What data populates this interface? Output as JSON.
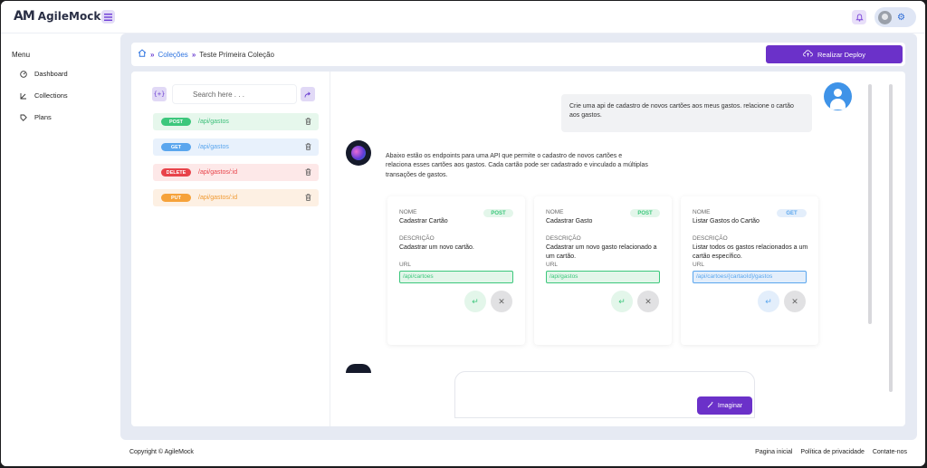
{
  "app": {
    "logo_mark": "AM",
    "name": "AgileMock"
  },
  "icons": {
    "menu_toggle": "menu-icon",
    "bell": "bell-icon",
    "gear": "gear-icon"
  },
  "sidebar": {
    "title": "Menu",
    "items": [
      {
        "label": "Dashboard",
        "icon": "dashboard-icon"
      },
      {
        "label": "Collections",
        "icon": "collections-icon"
      },
      {
        "label": "Plans",
        "icon": "tag-icon"
      }
    ]
  },
  "breadcrumb": {
    "sep": "»",
    "link": "Coleções",
    "current": "Teste Primeira Coleção"
  },
  "deploy_label": "Realizar Deploy",
  "endpoints": {
    "search_placeholder": "Search here . . .",
    "collapse_glyph": "{+}",
    "items": [
      {
        "method": "POST",
        "path": "/api/gastos",
        "color": "#3cc77c",
        "bg": "#e6f7ec",
        "text_color": "#3cbf79"
      },
      {
        "method": "GET",
        "path": "/api/gastos",
        "color": "#5aa6ee",
        "bg": "#e8f1fc",
        "text_color": "#5aa6ee"
      },
      {
        "method": "DELETE",
        "path": "/api/gastos/:id",
        "color": "#e8434a",
        "bg": "#fde8e8",
        "text_color": "#e8434a"
      },
      {
        "method": "PUT",
        "path": "/api/gastos/:id",
        "color": "#f6a23a",
        "bg": "#fdf0e3",
        "text_color": "#f09a33"
      }
    ]
  },
  "chat": {
    "user_message": "Crie uma api de cadastro de novos cartões aos meus gastos. relacione o cartão aos gastos.",
    "bot_message": "Abaixo estão os endpoints para uma API que permite o cadastro de novos cartões e relaciona esses cartões aos gastos. Cada cartão pode ser cadastrado e vinculado a múltiplas transações de gastos.",
    "card_labels": {
      "name": "NOME",
      "description": "DESCRIÇÃO",
      "url": "URL"
    },
    "cards": [
      {
        "name": "Cadastrar Cartão",
        "method": "POST",
        "description": "Cadastrar um novo cartão.",
        "url": "/api/cartoes",
        "accent": "#3cc77c",
        "badge_bg": "#e3f6ea"
      },
      {
        "name": "Cadastrar Gasto",
        "method": "POST",
        "description": "Cadastrar um novo gasto relacionado a um cartão.",
        "url": "/api/gastos",
        "accent": "#3cc77c",
        "badge_bg": "#e3f6ea"
      },
      {
        "name": "Listar Gastos do Cartão",
        "method": "GET",
        "description": "Listar todos os gastos relacionados a um cartão específico.",
        "url": "/api/cartoes/{cartaoId}/gastos",
        "accent": "#5aa6ee",
        "badge_bg": "#e3eefb"
      }
    ],
    "imagine_label": "Imaginar"
  },
  "footer": {
    "copyright": "Copyright © AgileMock",
    "links": [
      "Pagina inicial",
      "Política de privacidade",
      "Contate-nos"
    ]
  }
}
